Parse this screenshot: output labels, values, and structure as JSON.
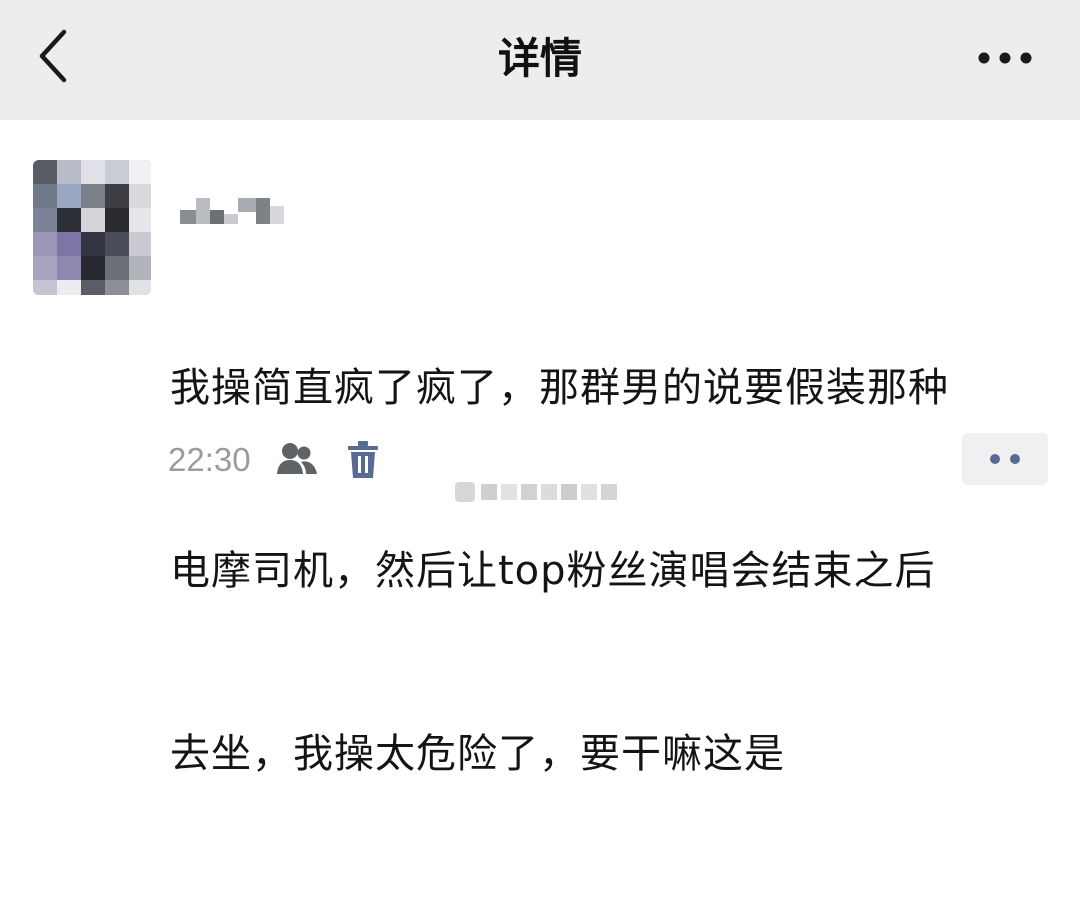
{
  "nav": {
    "title": "详情",
    "back_icon": "chevron-left-icon",
    "more_icon": "more-dots-icon"
  },
  "post": {
    "avatar": "avatar (pixelated)",
    "username": "",
    "text_lines": [
      "我操简直疯了疯了，那群男的说要假装那种",
      "电摩司机，然后让top粉丝演唱会结束之后",
      "去坐，我操太危险了，要干嘛这是"
    ],
    "time": "22:30",
    "visibility_icon": "friends-icon",
    "delete_icon": "trash-icon",
    "action_icon": "two-dots-icon"
  },
  "colors": {
    "nav_background": "#ededed",
    "page_background": "#ffffff",
    "text": "#141414",
    "meta_gray": "#9b9b9b",
    "icon_dark": "#576b95"
  }
}
